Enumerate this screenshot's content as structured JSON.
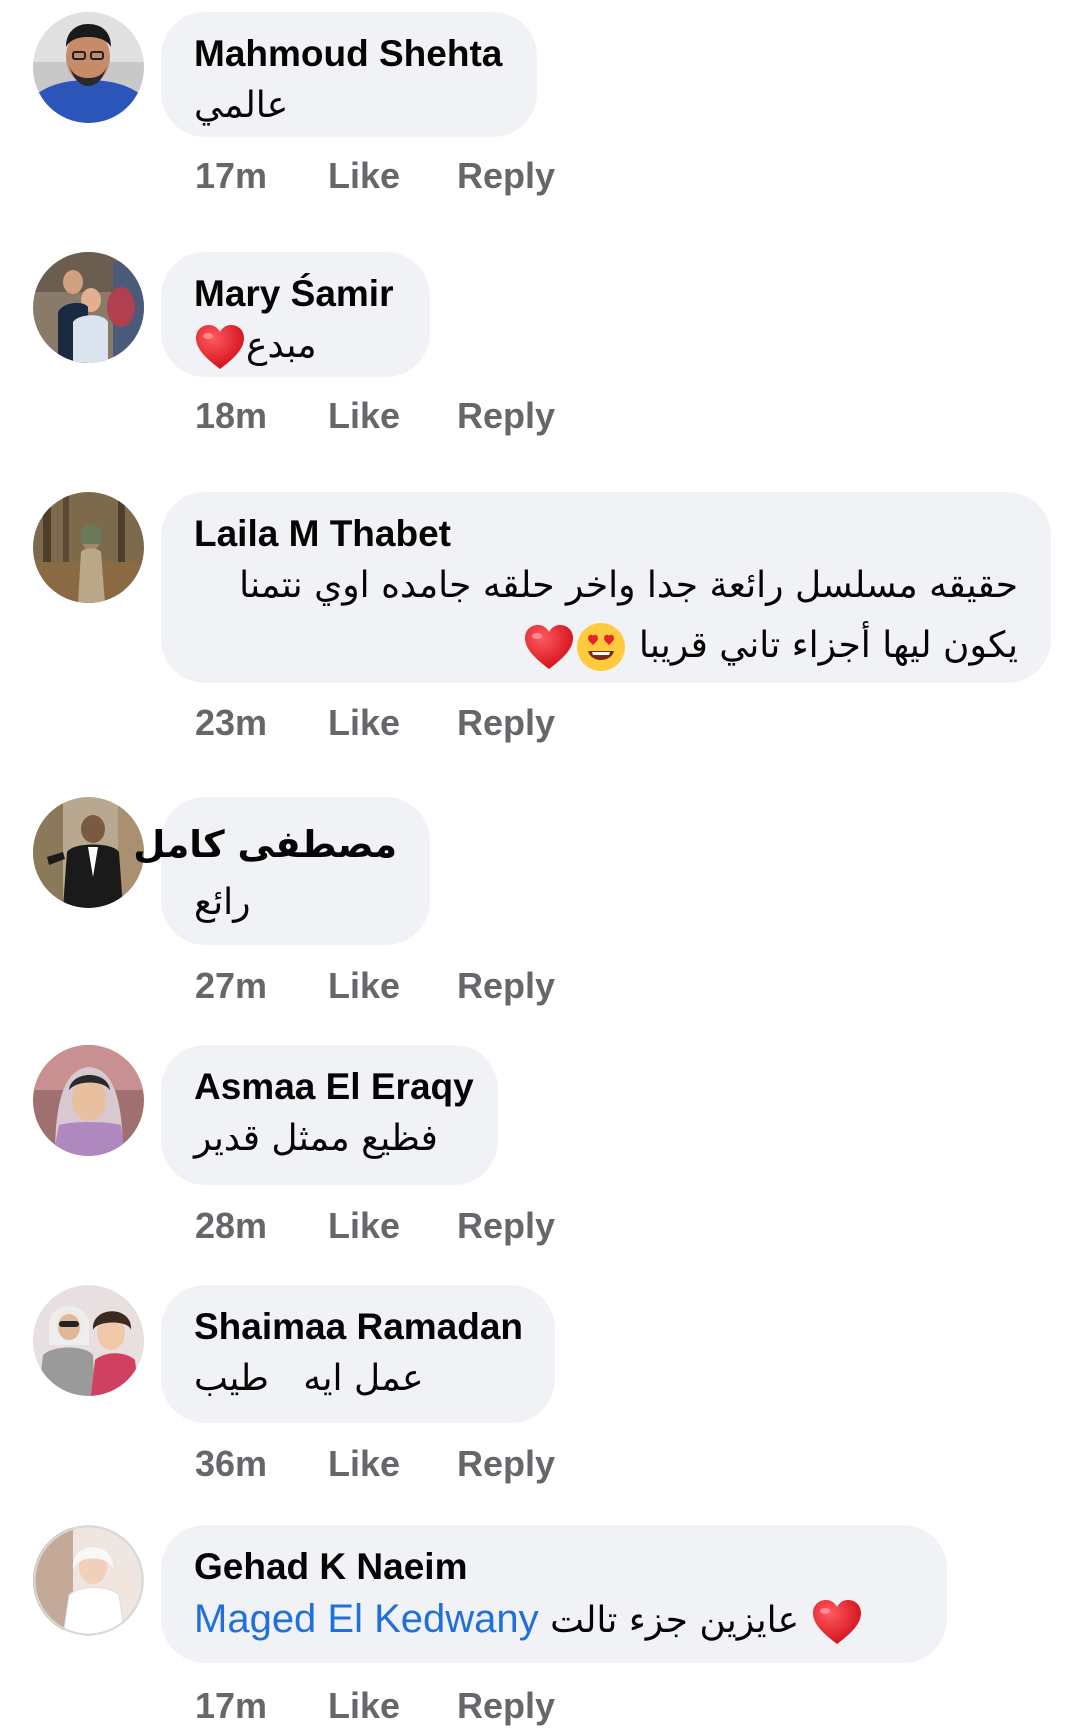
{
  "colors": {
    "bubble": "#f0f2f5",
    "author": "#050505",
    "meta": "#65676b",
    "mention": "#216fdb",
    "heart": "#e8202a"
  },
  "actions": {
    "like": "Like",
    "reply": "Reply"
  },
  "comments": [
    {
      "author": "Mahmoud Shehta",
      "text": "عالمي",
      "time": "17m",
      "avatar_icon": "avatar-man-blue-shirt"
    },
    {
      "author": "Mary Śamir",
      "text": "مبدع",
      "time": "18m",
      "avatar_icon": "avatar-group-photo",
      "emoji": "heart-icon"
    },
    {
      "author": "Laila M Thabet",
      "text_line1": "حقيقه مسلسل رائعة جدا واخر حلقه جامده اوي نتمنا",
      "text_line2": "يكون ليها أجزاء تاني قريبا",
      "time": "23m",
      "avatar_icon": "avatar-woman-forest",
      "emoji": "heart-eyes-icon heart-icon"
    },
    {
      "author": "مصطفى كامل",
      "text": "رائع",
      "time": "27m",
      "avatar_icon": "avatar-man-suit"
    },
    {
      "author": "Asmaa El Eraqy",
      "text": "فظيع ممثل قدير",
      "time": "28m",
      "avatar_icon": "avatar-woman-hijab-pink"
    },
    {
      "author": "Shaimaa Ramadan",
      "text": "عمل ايه   طيب",
      "time": "36m",
      "avatar_icon": "avatar-two-women"
    },
    {
      "author": "Gehad K Naeim",
      "mention": "Maged El Kedwany",
      "text": "عايزين جزء تالت",
      "time": "17m",
      "avatar_icon": "avatar-woman-white",
      "emoji": "heart-icon"
    }
  ]
}
